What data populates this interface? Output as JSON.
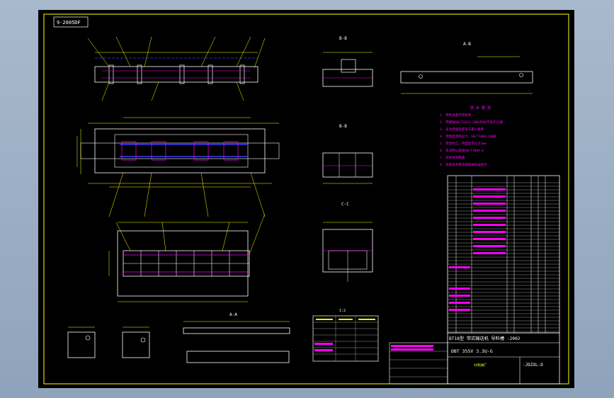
{
  "drawing": {
    "corner_tag": "9-2005DF",
    "view_labels": [
      "B-B",
      "B-B",
      "C-C",
      "A-A",
      "A-B"
    ],
    "scale_label": "1:2"
  },
  "notes": {
    "lines": [
      "1. 焊件表面不得有锈",
      "2. 焊缝按GB/T3323-2005检验不低于II级",
      "3. 未注焊缝高度等于最小板厚",
      "4. 焊接后消除应力，GB/T1804-2000",
      "5. 焊后校正，平面度不大于1mm",
      "6. 未注明公差按GB/T1804-m",
      "7. 涂防锈漆两遍",
      "8. 其余技术要求按相关标准执行"
    ]
  },
  "title_block": {
    "title": "BT18型 带式输送机 导料槽 -2002",
    "code": "DBT 355V 3.3U-G",
    "drawing_number": "-JDZXL-D",
    "company": "XX机械厂"
  },
  "colors": {
    "main": "#ffffff",
    "dim": "#ffff00",
    "accent": "#ff00ff",
    "blue": "#3a3aff",
    "border": "#ffff00"
  }
}
